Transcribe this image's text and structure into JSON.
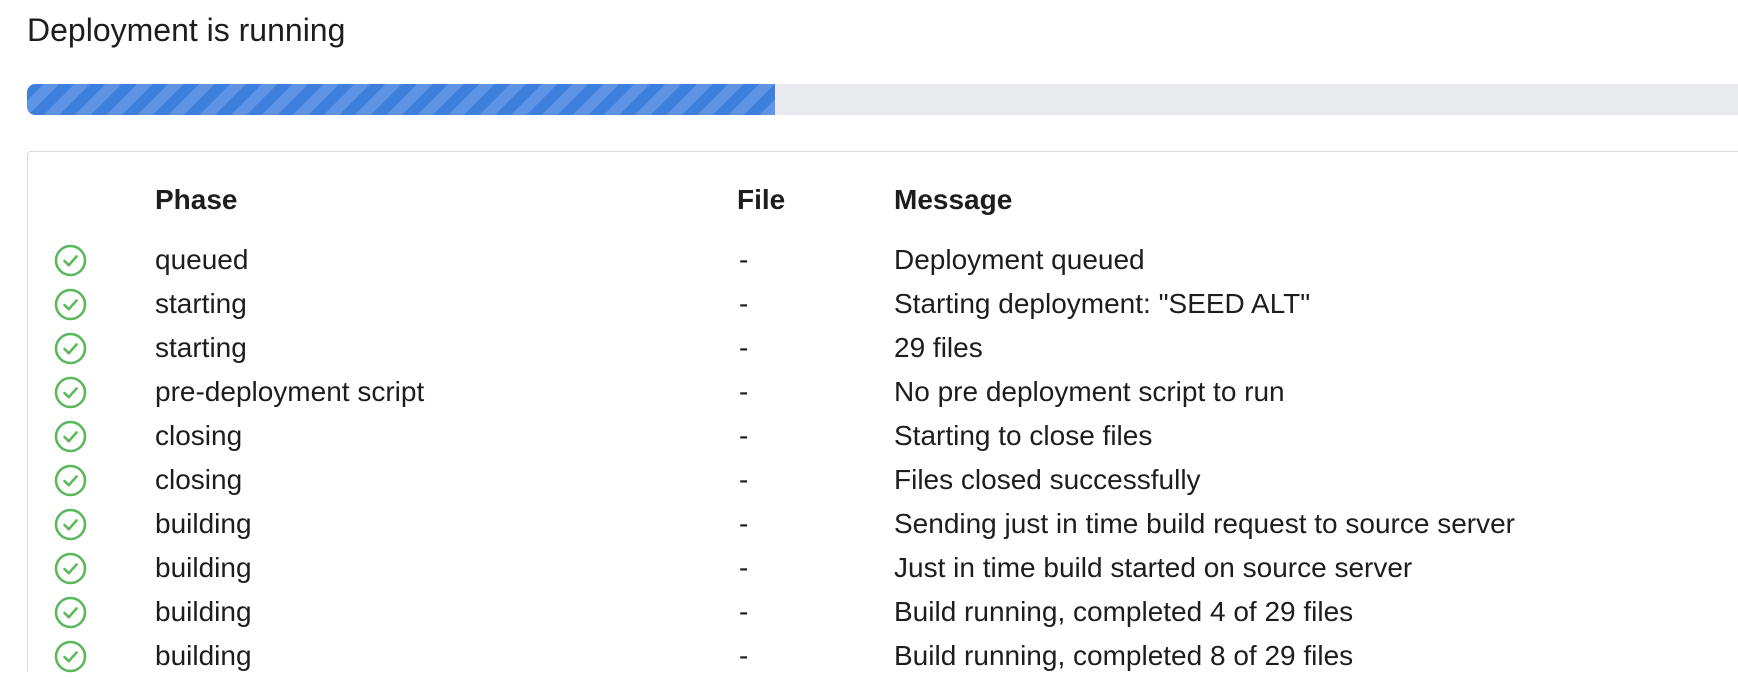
{
  "header": {
    "title": "Deployment is running"
  },
  "progress": {
    "percent": 43
  },
  "table": {
    "columns": {
      "phase": "Phase",
      "file": "File",
      "message": "Message"
    },
    "rows": [
      {
        "status": "success",
        "icon": "check-circle-icon",
        "phase": "queued",
        "file": "-",
        "message": "Deployment queued"
      },
      {
        "status": "success",
        "icon": "check-circle-icon",
        "phase": "starting",
        "file": "-",
        "message": "Starting  deployment: \"SEED ALT\""
      },
      {
        "status": "success",
        "icon": "check-circle-icon",
        "phase": "starting",
        "file": "-",
        "message": "29 files"
      },
      {
        "status": "success",
        "icon": "check-circle-icon",
        "phase": "pre-deployment script",
        "file": "-",
        "message": "No pre deployment script to run"
      },
      {
        "status": "success",
        "icon": "check-circle-icon",
        "phase": "closing",
        "file": "-",
        "message": "Starting to close files"
      },
      {
        "status": "success",
        "icon": "check-circle-icon",
        "phase": "closing",
        "file": "-",
        "message": "Files closed successfully"
      },
      {
        "status": "success",
        "icon": "check-circle-icon",
        "phase": "building",
        "file": "-",
        "message": "Sending just in time build request to source server"
      },
      {
        "status": "success",
        "icon": "check-circle-icon",
        "phase": "building",
        "file": "-",
        "message": "Just in time build started on source server"
      },
      {
        "status": "success",
        "icon": "check-circle-icon",
        "phase": "building",
        "file": "-",
        "message": "Build running, completed 4 of 29 files"
      },
      {
        "status": "success",
        "icon": "check-circle-icon",
        "phase": "building",
        "file": "-",
        "message": "Build running, completed 8 of 29 files"
      }
    ]
  },
  "colors": {
    "success": "#5cb85c",
    "progress": "#3f7fdc",
    "track": "#e9eaed"
  }
}
